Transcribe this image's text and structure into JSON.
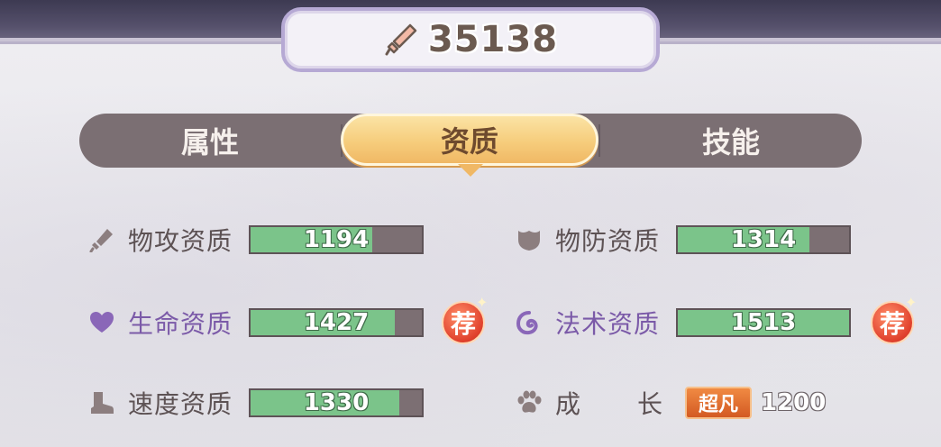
{
  "power": {
    "icon": "sword-icon",
    "value": "35138"
  },
  "tabs": [
    {
      "label": "属性",
      "active": false
    },
    {
      "label": "资质",
      "active": true
    },
    {
      "label": "技能",
      "active": false
    }
  ],
  "stats": [
    {
      "icon": "sword-icon",
      "label": "物攻资质",
      "value": "1194",
      "fill": 0.71,
      "recommended": false
    },
    {
      "icon": "shield-icon",
      "label": "物防资质",
      "value": "1314",
      "fill": 0.77,
      "recommended": false
    },
    {
      "icon": "heart-icon",
      "label": "生命资质",
      "value": "1427",
      "fill": 0.84,
      "recommended": true
    },
    {
      "icon": "magic-swirl-icon",
      "label": "法术资质",
      "value": "1513",
      "fill": 1.0,
      "recommended": true
    },
    {
      "icon": "boot-icon",
      "label": "速度资质",
      "value": "1330",
      "fill": 0.87,
      "recommended": false
    }
  ],
  "growth": {
    "icon": "paw-icon",
    "label_1": "成",
    "label_2": "长",
    "grade": "超凡",
    "value": "1200"
  },
  "recommend_badge": "荐",
  "colors": {
    "bar_fill": "#7bc48a",
    "bar_bg": "#7c6f73",
    "tab_active": "#f6cd7c",
    "recommend": "#e0402c",
    "grade": "#d35a23"
  }
}
